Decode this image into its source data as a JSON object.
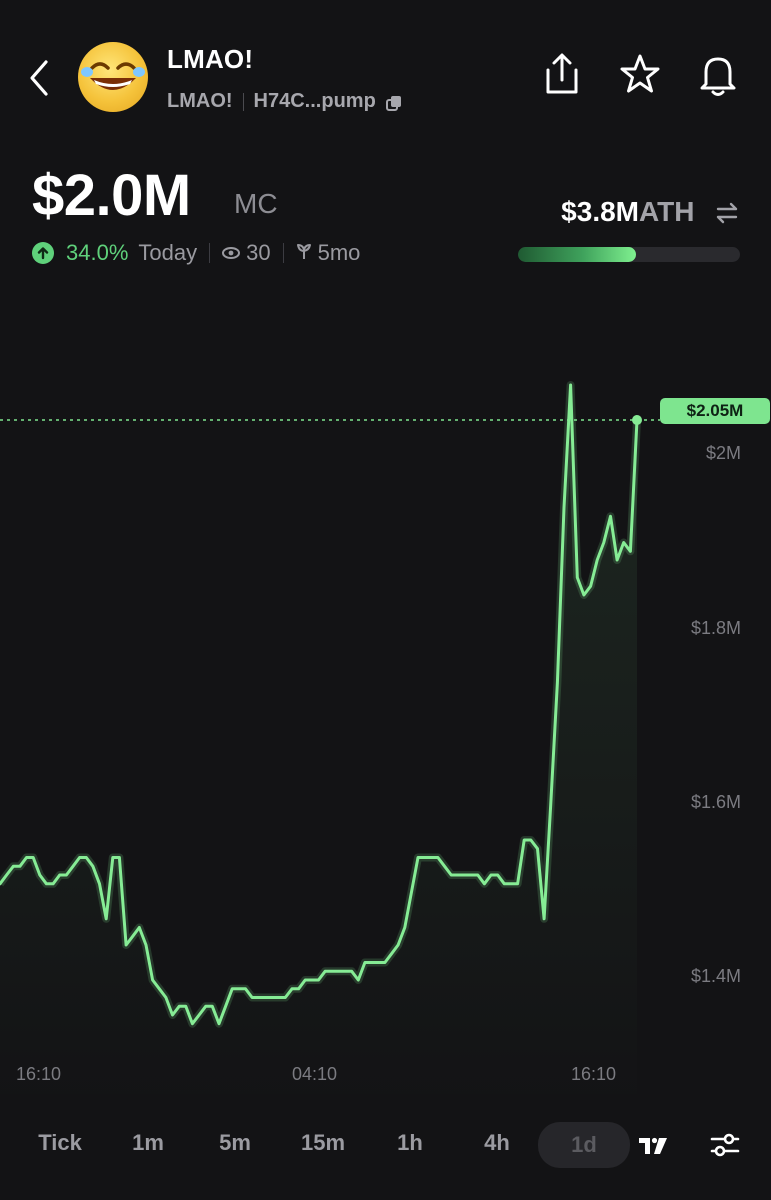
{
  "header": {
    "back_icon": "chevron-left-icon",
    "token_name": "LMAO!",
    "token_symbol": "LMAO!",
    "token_address": "H74C...pump",
    "copy_icon": "copy-icon",
    "actions": [
      "share-icon",
      "star-icon",
      "bell-icon"
    ]
  },
  "market": {
    "market_cap": "$2.0M",
    "unit": "MC",
    "change_pct": "34.0%",
    "change_period": "Today",
    "views": "30",
    "age": "5mo",
    "ath_value": "$3.8M",
    "ath_label": "ATH",
    "ath_progress": 0.53
  },
  "chart_data": {
    "type": "line",
    "current_price_label": "$2.05M",
    "current_price": 2.05,
    "y_ticks": [
      "$2M",
      "$1.8M",
      "$1.6M",
      "$1.4M"
    ],
    "x_ticks": [
      "16:10",
      "04:10",
      "16:10"
    ],
    "ylim": [
      1.29,
      2.13
    ],
    "unit": "$M",
    "x": [
      0,
      3,
      6,
      9,
      12,
      15,
      18,
      21,
      24,
      27,
      30,
      33,
      36,
      39,
      42,
      45,
      48,
      51,
      54,
      57,
      60,
      63,
      66,
      69,
      72,
      75,
      78,
      81,
      84,
      87,
      90,
      93,
      96,
      99,
      102,
      105,
      108,
      111,
      114,
      117,
      120,
      123,
      126,
      129,
      132,
      135,
      138,
      141,
      144,
      147,
      150,
      153,
      156,
      159,
      162,
      165,
      168,
      171,
      174,
      177,
      180,
      183,
      186,
      189,
      192,
      195,
      198,
      201,
      204,
      207,
      210,
      213,
      216,
      219,
      222,
      225,
      228,
      231,
      234,
      237,
      240,
      243,
      246,
      249,
      252,
      255,
      258,
      261,
      264,
      267,
      270,
      273,
      276,
      279,
      282,
      285,
      288
    ],
    "values": [
      1.52,
      1.53,
      1.54,
      1.54,
      1.55,
      1.55,
      1.53,
      1.52,
      1.52,
      1.53,
      1.53,
      1.54,
      1.55,
      1.55,
      1.54,
      1.52,
      1.48,
      1.55,
      1.55,
      1.45,
      1.46,
      1.47,
      1.45,
      1.41,
      1.4,
      1.39,
      1.37,
      1.38,
      1.38,
      1.36,
      1.37,
      1.38,
      1.38,
      1.36,
      1.38,
      1.4,
      1.4,
      1.4,
      1.39,
      1.39,
      1.39,
      1.39,
      1.39,
      1.39,
      1.4,
      1.4,
      1.41,
      1.41,
      1.41,
      1.42,
      1.42,
      1.42,
      1.42,
      1.42,
      1.41,
      1.43,
      1.43,
      1.43,
      1.43,
      1.44,
      1.45,
      1.47,
      1.51,
      1.55,
      1.55,
      1.55,
      1.55,
      1.54,
      1.53,
      1.53,
      1.53,
      1.53,
      1.53,
      1.52,
      1.53,
      1.53,
      1.52,
      1.52,
      1.52,
      1.57,
      1.57,
      1.56,
      1.48,
      1.61,
      1.75,
      1.95,
      2.09,
      1.87,
      1.85,
      1.86,
      1.89,
      1.91,
      1.94,
      1.89,
      1.91,
      1.9,
      2.05
    ]
  },
  "timeframes": [
    "Tick",
    "1m",
    "5m",
    "15m",
    "1h",
    "4h",
    "1d"
  ],
  "selected_timeframe": "1d",
  "bottom_icons": [
    "tradingview-icon",
    "settings-sliders-icon"
  ]
}
